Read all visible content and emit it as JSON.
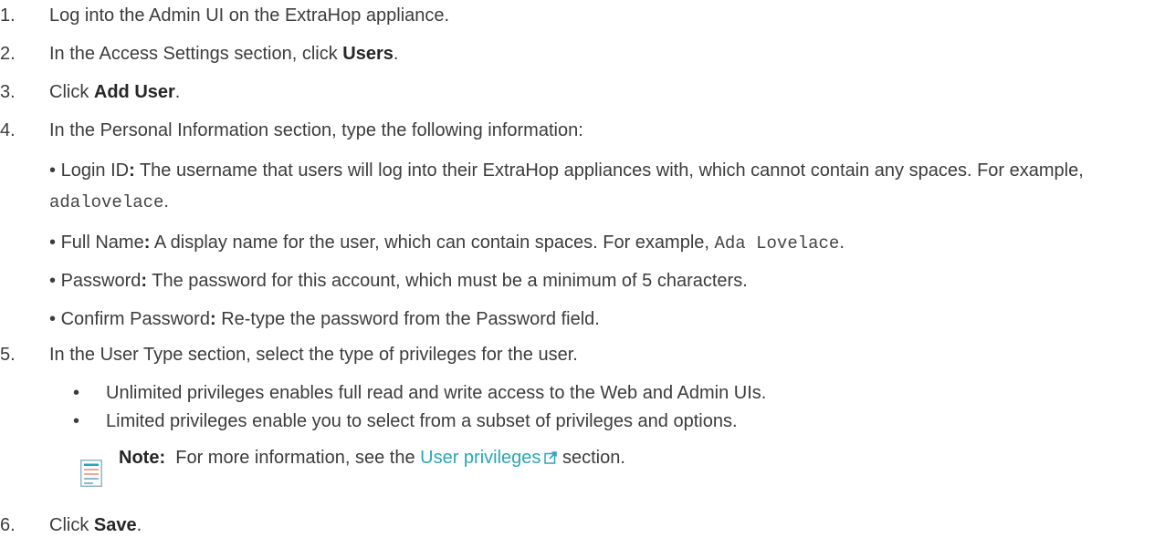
{
  "steps": [
    {
      "num": "1.",
      "text": "Log into the Admin UI on the ExtraHop appliance."
    },
    {
      "num": "2.",
      "pre": "In the Access Settings section, click ",
      "bold": "Users",
      "post": "."
    },
    {
      "num": "3.",
      "pre": "Click ",
      "bold": "Add User",
      "post": "."
    },
    {
      "num": "4.",
      "text": "In the Personal Information section, type the following information:"
    },
    {
      "num": "5.",
      "text": "In the User Type section, select the type of privileges for the user."
    },
    {
      "num": "6.",
      "pre": "Click ",
      "bold": "Save",
      "post": "."
    }
  ],
  "fields": [
    {
      "bullet": "•",
      "label": "Login ID",
      "colon": ":",
      "desc": " The username that users will log into their ExtraHop appliances with, which cannot contain any spaces. For example, ",
      "example": "adalovelace",
      "end": "."
    },
    {
      "bullet": "•",
      "label": "Full Name",
      "colon": ":",
      "desc": " A display name for the user, which can contain spaces. For example, ",
      "example": "Ada Lovelace",
      "end": "."
    },
    {
      "bullet": "•",
      "label": "Password",
      "colon": ":",
      "desc": " The password for this account, which must be a minimum of 5 characters."
    },
    {
      "bullet": "•",
      "label": "Confirm Password",
      "colon": ":",
      "desc": " Re-type the password from the Password field."
    }
  ],
  "privileges": [
    {
      "bullet": "•",
      "text": "Unlimited privileges enables full read and write access to the Web and Admin UIs."
    },
    {
      "bullet": "•",
      "text": "Limited privileges enable you to select from a subset of privileges and options."
    }
  ],
  "note": {
    "label": "Note:",
    "pre": "For more information, see the ",
    "link": "User privileges",
    "post": " section."
  },
  "colors": {
    "text": "#3c3c3c",
    "link": "#2aa6b8",
    "note_icon_top": "#2aa6b8",
    "note_icon_lines": "#f0a58c"
  }
}
